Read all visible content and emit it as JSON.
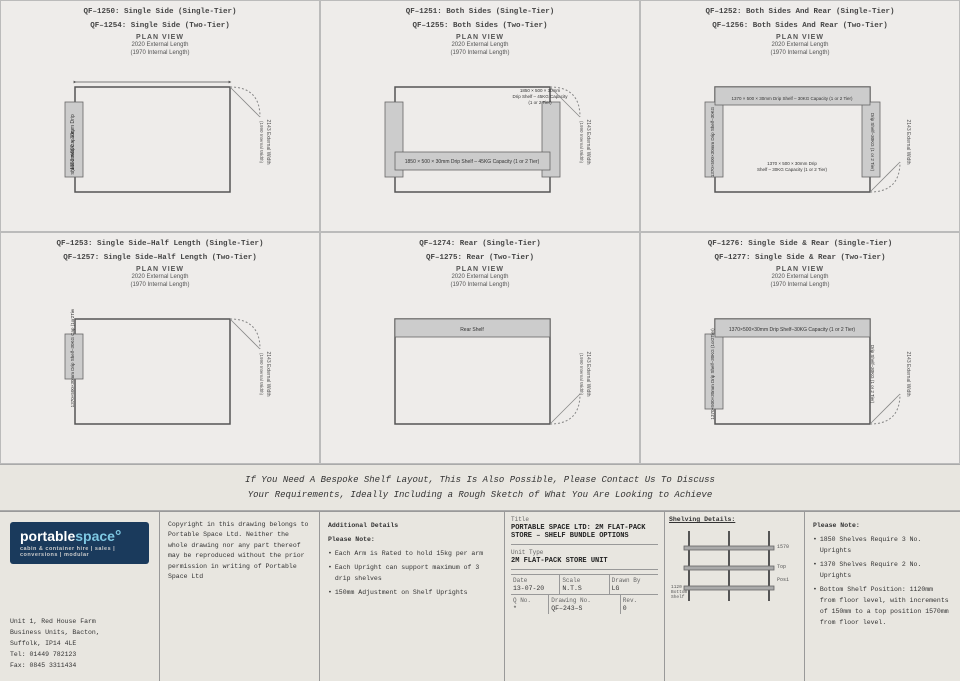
{
  "diagrams": [
    {
      "id": "d1",
      "title_lines": [
        "QF–1250: Single Side (Single-Tier)",
        "QF–1254: Single Side (Two-Tier)"
      ],
      "plan_view": "PLAN VIEW",
      "dim_external": "2020 External Length",
      "dim_internal": "(1970 Internal Length)",
      "type": "single_side"
    },
    {
      "id": "d2",
      "title_lines": [
        "QF–1251: Both Sides (Single-Tier)",
        "QF–1255: Both Sides (Two-Tier)"
      ],
      "plan_view": "PLAN VIEW",
      "dim_external": "2020 External Length",
      "dim_internal": "(1970 Internal Length)",
      "type": "both_sides"
    },
    {
      "id": "d3",
      "title_lines": [
        "QF–1252: Both Sides And Rear (Single-Tier)",
        "QF–1256: Both Sides And Rear (Two-Tier)"
      ],
      "plan_view": "PLAN VIEW",
      "dim_external": "2020 External Length",
      "dim_internal": "(1970 Internal Length)",
      "type": "both_sides_rear"
    },
    {
      "id": "d4",
      "title_lines": [
        "QF–1253: Single Side–Half Length (Single-Tier)",
        "QF–1257: Single Side–Half Length (Two-Tier)"
      ],
      "plan_view": "PLAN VIEW",
      "dim_external": "2020 External Length",
      "dim_internal": "(1970 Internal Length)",
      "type": "single_side_half"
    },
    {
      "id": "d5",
      "title_lines": [
        "QF–1274: Rear (Single-Tier)",
        "QF–1275: Rear (Two-Tier)"
      ],
      "plan_view": "PLAN VIEW",
      "dim_external": "2020 External Length",
      "dim_internal": "(1970 Internal Length)",
      "type": "rear"
    },
    {
      "id": "d6",
      "title_lines": [
        "QF–1276: Single Side & Rear (Single-Tier)",
        "QF–1277: Single Side & Rear (Two-Tier)"
      ],
      "plan_view": "PLAN VIEW",
      "dim_external": "2020 External Length",
      "dim_internal": "(1970 Internal Length)",
      "type": "single_side_rear"
    }
  ],
  "info_text": {
    "line1": "If You Need A Bespoke Shelf Layout, This Is Also Possible, Please Contact Us To Discuss",
    "line2": "Your Requirements, Ideally Including a Rough Sketch of What You Are Looking to Achieve"
  },
  "footer": {
    "logo": {
      "portable": "portable",
      "space": "space",
      "subtitle": "cabin & container hire | sales | conversions | modular"
    },
    "contact": {
      "address1": "Unit 1, Red House Farm",
      "address2": "Business Units, Bacton,",
      "address3": "Suffolk, IP14 4LE",
      "tel": "Tel:  01449 782123",
      "fax": "Fax: 0845 3311434"
    },
    "copyright": "Copyright in this drawing belongs to Portable Space Ltd. Neither the whole drawing nor any part thereof may be reproduced without the prior permission in writing of Portable Space Ltd",
    "additional": {
      "title": "Additional Details",
      "note_title": "Please Note:",
      "bullets": [
        "Each Arm is Rated to hold 15kg per arm",
        "Each Upright can support maximum of 3 drip shelves",
        "150mm Adjustment on Shelf Uprights"
      ]
    },
    "title_box": {
      "title_label": "Title",
      "title_value": "PORTABLE SPACE LTD: 2M FLAT-PACK STORE – SHELF BUNDLE OPTIONS",
      "unit_label": "Unit Type",
      "unit_value": "2M FLAT-PACK STORE UNIT",
      "date_label": "Date",
      "date_value": "13-07-20",
      "scale_label": "Scale",
      "scale_value": "N.T.S",
      "drawn_label": "Drawn By",
      "drawn_value": "LG",
      "doc_label": "Q No.",
      "doc_value": "*",
      "drawing_label": "Drawing No.",
      "drawing_value": "QF–243–S",
      "rev_label": "Rev.",
      "rev_value": "0"
    },
    "shelving": {
      "title": "Shelving Details:",
      "note_title": "Please Note:",
      "notes": [
        "1850 Shelves Require 3 No. Uprights",
        "1370 Shelves Require 2 No. Uprights",
        "Bottom Shelf Position: 1120mm from floor level, with increments of 150mm to a top position 1570mm from floor level."
      ]
    }
  }
}
